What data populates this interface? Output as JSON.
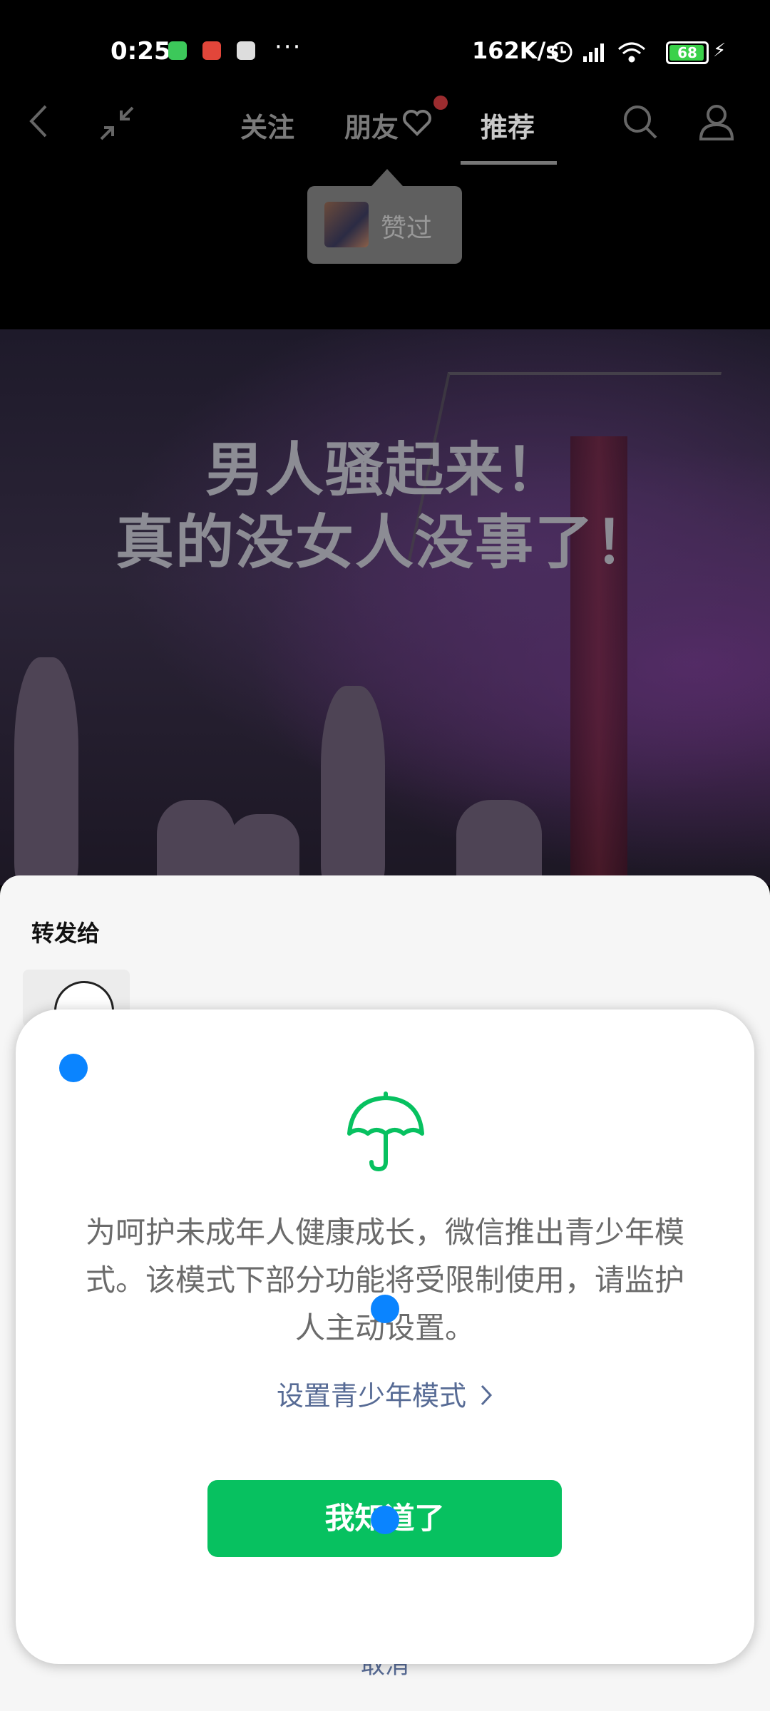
{
  "status_bar": {
    "time": "0:25",
    "more": "···",
    "network_speed": "162K/s",
    "battery": "68"
  },
  "nav": {
    "tabs": [
      {
        "label": "关注"
      },
      {
        "label": "朋友"
      },
      {
        "label": "推荐"
      }
    ],
    "active_tab": "推荐"
  },
  "liked_tooltip": {
    "label": "赞过"
  },
  "video": {
    "caption_line1": "男人骚起来！",
    "caption_line2": "真的没女人没事了！"
  },
  "forward_sheet": {
    "title": "转发给",
    "cancel_label": "取消"
  },
  "youth_dialog": {
    "message": "为呵护未成年人健康成长，微信推出青少年模式。该模式下部分功能将受限制使用，请监护人主动设置。",
    "link_label": "设置青少年模式",
    "button_label": "我知道了"
  },
  "colors": {
    "accent_green": "#07c160",
    "link_blue": "#576b95",
    "touch_blue": "#0a84ff"
  }
}
